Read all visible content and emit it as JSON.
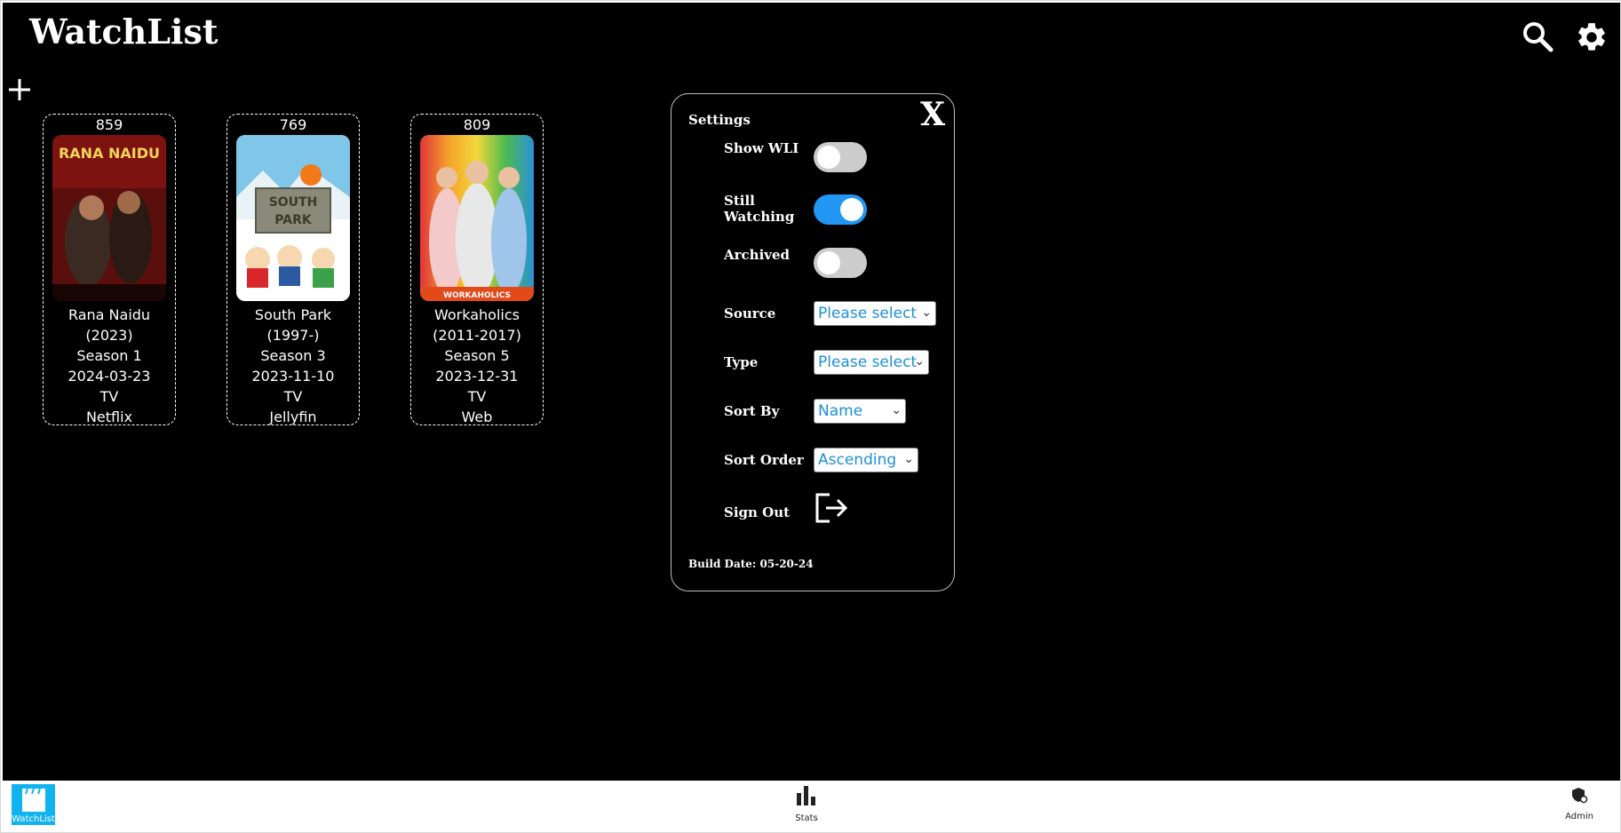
{
  "app": {
    "title": "WatchList"
  },
  "colors": {
    "background": "#000000",
    "accent": "#2196f3",
    "nav_active": "#11b3ef"
  },
  "cards": [
    {
      "count": "859",
      "title": "Rana Naidu",
      "years": "(2023)",
      "season": "Season 1",
      "date": "2024-03-23",
      "type": "TV",
      "source": "Netflix",
      "poster_text": "RANA NAIDU"
    },
    {
      "count": "769",
      "title": "South Park",
      "years": "(1997-)",
      "season": "Season 3",
      "date": "2023-11-10",
      "type": "TV",
      "source": "Jellyfin",
      "poster_text": "SOUTH PARK"
    },
    {
      "count": "809",
      "title": "Workaholics",
      "years": "(2011-2017)",
      "season": "Season 5",
      "date": "2023-12-31",
      "type": "TV",
      "source": "Web",
      "poster_text": "WORKAHOLICS"
    }
  ],
  "settings": {
    "title": "Settings",
    "close_label": "X",
    "show_wli_label": "Show WLI",
    "show_wli_on": false,
    "still_watching_label": "Still Watching",
    "still_watching_on": true,
    "archived_label": "Archived",
    "archived_on": false,
    "source_label": "Source",
    "source_value": "Please select",
    "type_label": "Type",
    "type_value": "Please select",
    "sort_by_label": "Sort By",
    "sort_by_value": "Name",
    "sort_order_label": "Sort Order",
    "sort_order_value": "Ascending",
    "sign_out_label": "Sign Out",
    "build_date": "Build Date: 05-20-24"
  },
  "nav": {
    "watchlist_label": "WatchList",
    "stats_label": "Stats",
    "admin_label": "Admin"
  }
}
